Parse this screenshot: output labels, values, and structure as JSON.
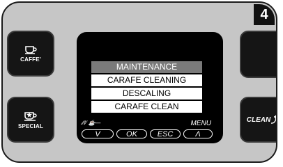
{
  "step_number": "4",
  "left_buttons": {
    "caffe": {
      "label": "CAFFE'",
      "icon": "coffee-cup-icon"
    },
    "special": {
      "label": "SPECIAL",
      "icon": "star-cup-icon"
    }
  },
  "right_buttons": {
    "top": {
      "icon": "partial-button"
    },
    "clean": {
      "label": "CLEAN",
      "icon": "clean-plus-icon"
    }
  },
  "display": {
    "menu_items": [
      "MAINTENANCE",
      "CARAFE CLEANING",
      "DESCALING",
      "CARAFE CLEAN"
    ],
    "selected_index": 0
  },
  "softkeys": {
    "left_hint": "∕∕/∕ ☕—",
    "menu_label": "MENU",
    "down": "V",
    "ok": "OK",
    "esc": "ESC",
    "up": "Λ"
  }
}
